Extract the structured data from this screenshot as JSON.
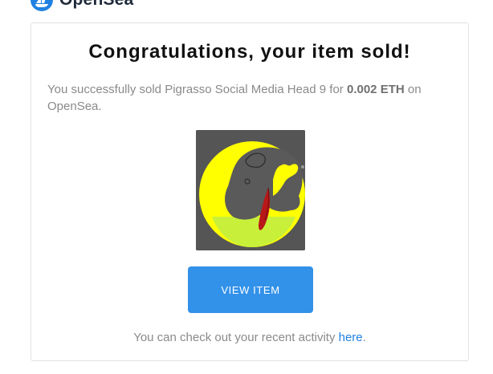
{
  "brand": {
    "name": "OpenSea",
    "logo_icon": "opensea-logo-icon",
    "accent_color": "#2081e2"
  },
  "email": {
    "headline": "Congratulations, your item sold!",
    "message_prefix": "You successfully sold Pigrasso Social Media Head 9 for ",
    "price": "0.002 ETH",
    "message_suffix": " on OpenSea.",
    "item_image_icon": "nft-artwork-image",
    "button_label": "VIEW ITEM",
    "button_color": "#3291e9",
    "activity_prefix": "You can check out your recent activity ",
    "activity_link": "here",
    "activity_suffix": "."
  }
}
